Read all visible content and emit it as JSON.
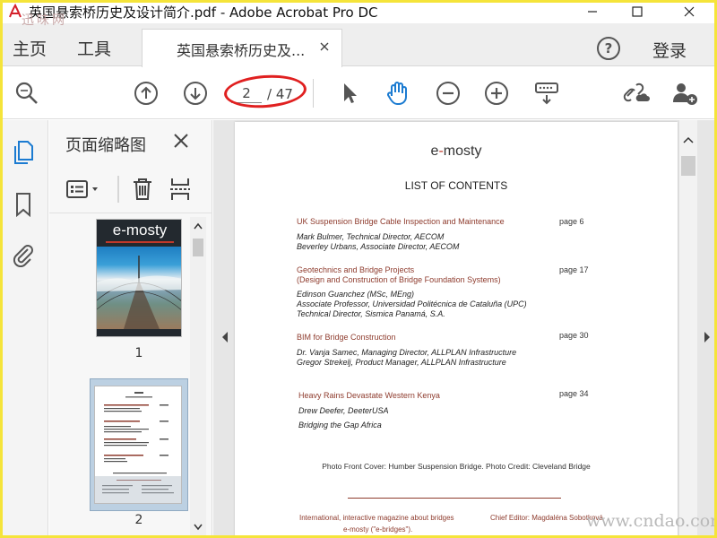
{
  "window": {
    "title": "英国悬索桥历史及设计简介.pdf - Adobe Acrobat Pro DC",
    "watermark_top": "迅味网",
    "watermark_bottom": "www.cndao.com"
  },
  "tabs": {
    "home": "主页",
    "tools": "工具",
    "document": "英国悬索桥历史及...",
    "help": "?",
    "login": "登录"
  },
  "toolbar": {
    "current_page": "2",
    "total_pages": "/ 47"
  },
  "thumbnails": {
    "panel_title": "页面缩略图",
    "pages": [
      {
        "number": "1",
        "cover_brand": "e-mosty"
      },
      {
        "number": "2"
      }
    ]
  },
  "document": {
    "brand_left": "e",
    "brand_dash": "-",
    "brand_right": "mosty",
    "toc_title": "LIST OF CONTENTS",
    "entries": [
      {
        "title": "UK Suspension Bridge Cable Inspection and Maintenance",
        "page": "page  6",
        "lines": [
          "Mark Bulmer, Technical Director, AECOM",
          "Beverley Urbans, Associate Director, AECOM"
        ]
      },
      {
        "title": "Geotechnics and Bridge Projects",
        "subtitle": "(Design and Construction of Bridge Foundation Systems)",
        "page": "page 17",
        "lines": [
          "Edinson Guanchez (MSc, MEng)",
          "Associate Professor, Universidad Politécnica de Cataluña (UPC)",
          "Technical Director, Sismica Panamá, S.A."
        ]
      },
      {
        "title": "BIM for Bridge Construction",
        "page": "page 30",
        "lines": [
          "Dr. Vanja Samec, Managing Director, ALLPLAN Infrastructure",
          "Gregor Strekelj, Product Manager, ALLPLAN Infrastructure"
        ]
      },
      {
        "title": "Heavy Rains Devastate Western Kenya",
        "page": "page 34",
        "lines": [
          "Drew Deefer, DeeterUSA",
          "Bridging the Gap Africa"
        ]
      }
    ],
    "photo_credit": "Photo Front Cover: Humber Suspension Bridge. Photo Credit: Cleveland Bridge",
    "footer_left_1": "International, interactive magazine about bridges",
    "footer_left_2": "e-mosty (\"e-bridges\").",
    "footer_right_1": "Chief Editor: Magdaléna Sobotková"
  },
  "colors": {
    "accent_blue": "#1b7bd1",
    "link_red": "#8e3b2d",
    "annotation_red": "#e02020"
  }
}
